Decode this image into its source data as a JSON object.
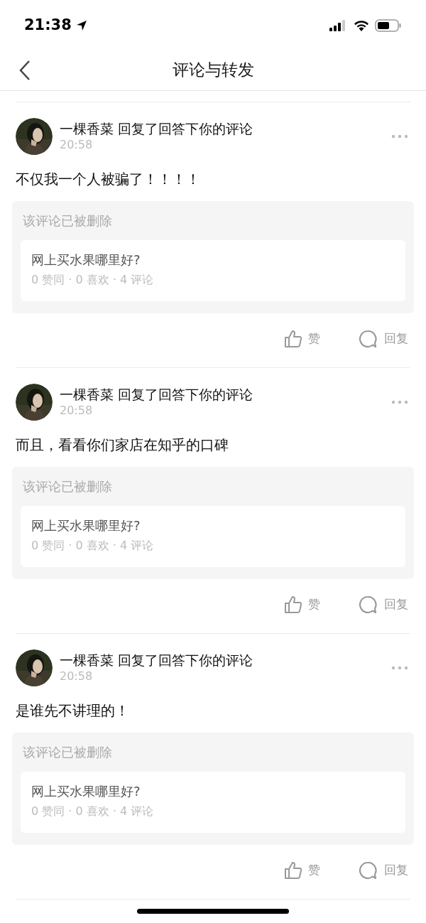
{
  "status_bar": {
    "time": "21:38"
  },
  "nav": {
    "title": "评论与转发"
  },
  "items": [
    {
      "author": "一棵香菜",
      "action": "回复了回答下你的评论",
      "time": "20:58",
      "content": "不仅我一个人被骗了！！！！",
      "quoted": {
        "notice": "该评论已被删除",
        "question": "网上买水果哪里好?",
        "stats": "0 赞同 · 0 喜欢 · 4 评论"
      },
      "like_label": "赞",
      "reply_label": "回复"
    },
    {
      "author": "一棵香菜",
      "action": "回复了回答下你的评论",
      "time": "20:58",
      "content": "而且，看看你们家店在知乎的口碑",
      "quoted": {
        "notice": "该评论已被删除",
        "question": "网上买水果哪里好?",
        "stats": "0 赞同 · 0 喜欢 · 4 评论"
      },
      "like_label": "赞",
      "reply_label": "回复"
    },
    {
      "author": "一棵香菜",
      "action": "回复了回答下你的评论",
      "time": "20:58",
      "content": "是谁先不讲理的！",
      "quoted": {
        "notice": "该评论已被删除",
        "question": "网上买水果哪里好?",
        "stats": "0 赞同 · 0 喜欢 · 4 评论"
      },
      "like_label": "赞",
      "reply_label": "回复"
    }
  ]
}
